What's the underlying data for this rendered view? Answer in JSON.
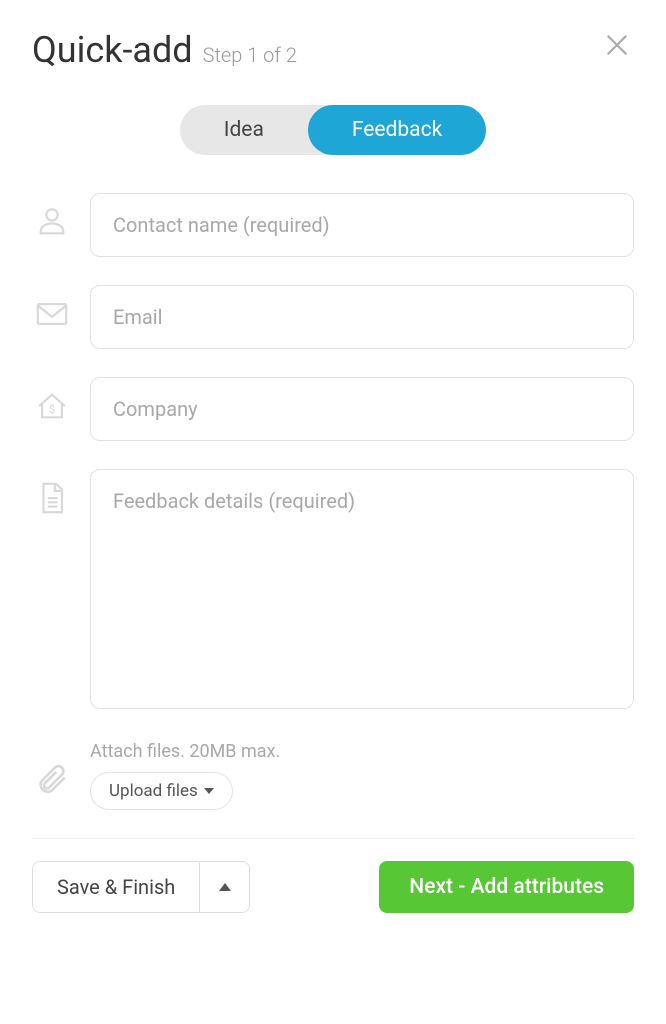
{
  "header": {
    "title": "Quick-add",
    "step": "Step 1 of 2"
  },
  "tabs": {
    "idea": "Idea",
    "feedback": "Feedback",
    "active": "feedback"
  },
  "fields": {
    "contact_name": {
      "placeholder": "Contact name (required)",
      "value": ""
    },
    "email": {
      "placeholder": "Email",
      "value": ""
    },
    "company": {
      "placeholder": "Company",
      "value": ""
    },
    "details": {
      "placeholder": "Feedback details (required)",
      "value": ""
    }
  },
  "attach": {
    "label": "Attach files. 20MB max.",
    "button": "Upload files"
  },
  "footer": {
    "save": "Save & Finish",
    "next": "Next - Add attributes"
  }
}
